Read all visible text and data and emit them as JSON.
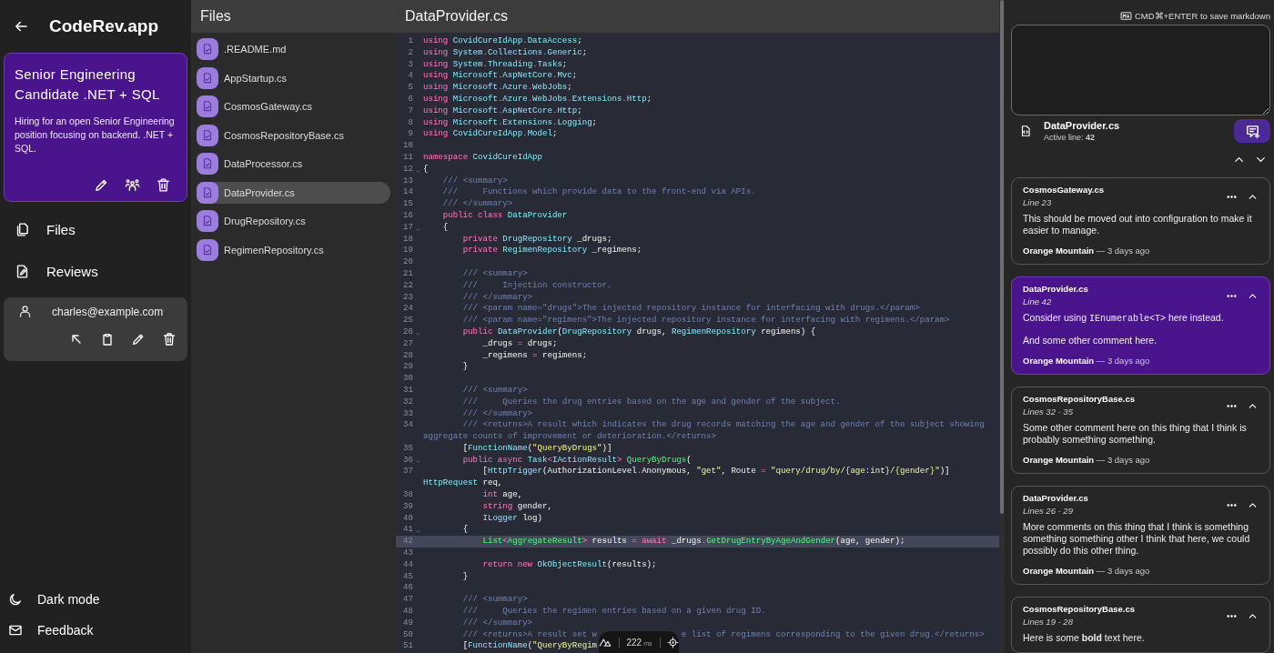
{
  "sidebar": {
    "app_title": "CodeRev.app",
    "project": {
      "title": "Senior Engineering Candidate .NET + SQL",
      "description": "Hiring for an open Senior Engineering position focusing on backend. .NET + SQL."
    },
    "nav": [
      {
        "label": "Files"
      },
      {
        "label": "Reviews"
      }
    ],
    "user": {
      "email": "charles@example.com"
    },
    "footer": [
      {
        "label": "Dark mode"
      },
      {
        "label": "Feedback"
      }
    ]
  },
  "files": {
    "title": "Files",
    "items": [
      {
        "name": ".README.md",
        "selected": false
      },
      {
        "name": "AppStartup.cs",
        "selected": false
      },
      {
        "name": "CosmosGateway.cs",
        "selected": false
      },
      {
        "name": "CosmosRepositoryBase.cs",
        "selected": false
      },
      {
        "name": "DataProcessor.cs",
        "selected": false
      },
      {
        "name": "DataProvider.cs",
        "selected": true
      },
      {
        "name": "DrugRepository.cs",
        "selected": false
      },
      {
        "name": "RegimenRepository.cs",
        "selected": false
      }
    ]
  },
  "editor": {
    "title": "DataProvider.cs",
    "perf": {
      "value": "222",
      "unit": "ms"
    },
    "lines": [
      {
        "n": "1",
        "fold": false,
        "active": false,
        "tokens": [
          {
            "kind": "kw",
            "text": "using "
          },
          {
            "kind": "ty",
            "text": "CovidCureIdApp"
          },
          {
            "kind": "op",
            "text": "."
          },
          {
            "kind": "ty",
            "text": "DataAccess"
          },
          {
            "kind": "tx",
            "text": ";"
          }
        ]
      },
      {
        "n": "2",
        "fold": false,
        "active": false,
        "tokens": [
          {
            "kind": "kw",
            "text": "using "
          },
          {
            "kind": "ty",
            "text": "System"
          },
          {
            "kind": "op",
            "text": "."
          },
          {
            "kind": "ty",
            "text": "Collections"
          },
          {
            "kind": "op",
            "text": "."
          },
          {
            "kind": "ty",
            "text": "Generic"
          },
          {
            "kind": "tx",
            "text": ";"
          }
        ]
      },
      {
        "n": "3",
        "fold": false,
        "active": false,
        "tokens": [
          {
            "kind": "kw",
            "text": "using "
          },
          {
            "kind": "ty",
            "text": "System"
          },
          {
            "kind": "op",
            "text": "."
          },
          {
            "kind": "ty",
            "text": "Threading"
          },
          {
            "kind": "op",
            "text": "."
          },
          {
            "kind": "ty",
            "text": "Tasks"
          },
          {
            "kind": "tx",
            "text": ";"
          }
        ]
      },
      {
        "n": "4",
        "fold": false,
        "active": false,
        "tokens": [
          {
            "kind": "kw",
            "text": "using "
          },
          {
            "kind": "ty",
            "text": "Microsoft"
          },
          {
            "kind": "op",
            "text": "."
          },
          {
            "kind": "ty",
            "text": "AspNetCore"
          },
          {
            "kind": "op",
            "text": "."
          },
          {
            "kind": "ty",
            "text": "Mvc"
          },
          {
            "kind": "tx",
            "text": ";"
          }
        ]
      },
      {
        "n": "5",
        "fold": false,
        "active": false,
        "tokens": [
          {
            "kind": "kw",
            "text": "using "
          },
          {
            "kind": "ty",
            "text": "Microsoft"
          },
          {
            "kind": "op",
            "text": "."
          },
          {
            "kind": "ty",
            "text": "Azure"
          },
          {
            "kind": "op",
            "text": "."
          },
          {
            "kind": "ty",
            "text": "WebJobs"
          },
          {
            "kind": "tx",
            "text": ";"
          }
        ]
      },
      {
        "n": "6",
        "fold": false,
        "active": false,
        "tokens": [
          {
            "kind": "kw",
            "text": "using "
          },
          {
            "kind": "ty",
            "text": "Microsoft"
          },
          {
            "kind": "op",
            "text": "."
          },
          {
            "kind": "ty",
            "text": "Azure"
          },
          {
            "kind": "op",
            "text": "."
          },
          {
            "kind": "ty",
            "text": "WebJobs"
          },
          {
            "kind": "op",
            "text": "."
          },
          {
            "kind": "ty",
            "text": "Extensions"
          },
          {
            "kind": "op",
            "text": "."
          },
          {
            "kind": "ty",
            "text": "Http"
          },
          {
            "kind": "tx",
            "text": ";"
          }
        ]
      },
      {
        "n": "7",
        "fold": false,
        "active": false,
        "tokens": [
          {
            "kind": "kw",
            "text": "using "
          },
          {
            "kind": "ty",
            "text": "Microsoft"
          },
          {
            "kind": "op",
            "text": "."
          },
          {
            "kind": "ty",
            "text": "AspNetCore"
          },
          {
            "kind": "op",
            "text": "."
          },
          {
            "kind": "ty",
            "text": "Http"
          },
          {
            "kind": "tx",
            "text": ";"
          }
        ]
      },
      {
        "n": "8",
        "fold": false,
        "active": false,
        "tokens": [
          {
            "kind": "kw",
            "text": "using "
          },
          {
            "kind": "ty",
            "text": "Microsoft"
          },
          {
            "kind": "op",
            "text": "."
          },
          {
            "kind": "ty",
            "text": "Extensions"
          },
          {
            "kind": "op",
            "text": "."
          },
          {
            "kind": "ty",
            "text": "Logging"
          },
          {
            "kind": "tx",
            "text": ";"
          }
        ]
      },
      {
        "n": "9",
        "fold": false,
        "active": false,
        "tokens": [
          {
            "kind": "kw",
            "text": "using "
          },
          {
            "kind": "ty",
            "text": "CovidCureIdApp"
          },
          {
            "kind": "op",
            "text": "."
          },
          {
            "kind": "ty",
            "text": "Model"
          },
          {
            "kind": "tx",
            "text": ";"
          }
        ]
      },
      {
        "n": "10",
        "fold": false,
        "active": false
      },
      {
        "n": "11",
        "fold": false,
        "active": false,
        "tokens": [
          {
            "kind": "kw",
            "text": "namespace "
          },
          {
            "kind": "ty",
            "text": "CovidCureIdApp"
          }
        ]
      },
      {
        "n": "12",
        "fold": true,
        "active": false,
        "tokens": [
          {
            "kind": "tx",
            "text": "{"
          }
        ]
      },
      {
        "n": "13",
        "fold": false,
        "active": false,
        "tokens": [
          {
            "kind": "cm",
            "text": "    /// <summary>"
          }
        ]
      },
      {
        "n": "14",
        "fold": false,
        "active": false,
        "tokens": [
          {
            "kind": "cm",
            "text": "    ///     Functions which provide data to the front-end via APIs."
          }
        ]
      },
      {
        "n": "15",
        "fold": false,
        "active": false,
        "tokens": [
          {
            "kind": "cm",
            "text": "    /// </summary>"
          }
        ]
      },
      {
        "n": "16",
        "fold": false,
        "active": false,
        "tokens": [
          {
            "kind": "kw",
            "text": "    public class "
          },
          {
            "kind": "ty",
            "text": "DataProvider"
          }
        ]
      },
      {
        "n": "17",
        "fold": true,
        "active": false,
        "tokens": [
          {
            "kind": "tx",
            "text": "    {"
          }
        ]
      },
      {
        "n": "18",
        "fold": false,
        "active": false,
        "tokens": [
          {
            "kind": "kw",
            "text": "        private "
          },
          {
            "kind": "ty",
            "text": "DrugRepository"
          },
          {
            "kind": "tx",
            "text": " _drugs;"
          }
        ]
      },
      {
        "n": "19",
        "fold": false,
        "active": false,
        "tokens": [
          {
            "kind": "kw",
            "text": "        private "
          },
          {
            "kind": "ty",
            "text": "RegimenRepository"
          },
          {
            "kind": "tx",
            "text": " _regimens;"
          }
        ]
      },
      {
        "n": "20",
        "fold": false,
        "active": false
      },
      {
        "n": "21",
        "fold": false,
        "active": false,
        "tokens": [
          {
            "kind": "cm",
            "text": "        /// <summary>"
          }
        ]
      },
      {
        "n": "22",
        "fold": false,
        "active": false,
        "tokens": [
          {
            "kind": "cm",
            "text": "        ///     Injection constructor."
          }
        ]
      },
      {
        "n": "23",
        "fold": false,
        "active": false,
        "tokens": [
          {
            "kind": "cm",
            "text": "        /// </summary>"
          }
        ]
      },
      {
        "n": "24",
        "fold": false,
        "active": false,
        "tokens": [
          {
            "kind": "cm",
            "text": "        /// <param name=\"drugs\">The injected repository instance for interfacing with drugs.</param>"
          }
        ]
      },
      {
        "n": "25",
        "fold": false,
        "active": false,
        "tokens": [
          {
            "kind": "cm",
            "text": "        /// <param name=\"regimens\">The injected repository instance for interfacing with regimens.</param>"
          }
        ]
      },
      {
        "n": "26",
        "fold": true,
        "active": false,
        "tokens": [
          {
            "kind": "kw",
            "text": "        public "
          },
          {
            "kind": "ty",
            "text": "DataProvider"
          },
          {
            "kind": "tx",
            "text": "("
          },
          {
            "kind": "ty",
            "text": "DrugRepository"
          },
          {
            "kind": "tx",
            "text": " drugs, "
          },
          {
            "kind": "ty",
            "text": "RegimenRepository"
          },
          {
            "kind": "tx",
            "text": " regimens) {"
          }
        ]
      },
      {
        "n": "27",
        "fold": false,
        "active": false,
        "tokens": [
          {
            "kind": "tx",
            "text": "            _drugs "
          },
          {
            "kind": "op",
            "text": "="
          },
          {
            "kind": "tx",
            "text": " drugs;"
          }
        ]
      },
      {
        "n": "28",
        "fold": false,
        "active": false,
        "tokens": [
          {
            "kind": "tx",
            "text": "            _regimens "
          },
          {
            "kind": "op",
            "text": "="
          },
          {
            "kind": "tx",
            "text": " regimens;"
          }
        ]
      },
      {
        "n": "29",
        "fold": false,
        "active": false,
        "tokens": [
          {
            "kind": "tx",
            "text": "        }"
          }
        ]
      },
      {
        "n": "30",
        "fold": false,
        "active": false
      },
      {
        "n": "31",
        "fold": false,
        "active": false,
        "tokens": [
          {
            "kind": "cm",
            "text": "        /// <summary>"
          }
        ]
      },
      {
        "n": "32",
        "fold": false,
        "active": false,
        "tokens": [
          {
            "kind": "cm",
            "text": "        ///     Queries the drug entries based on the age and gender of the subject."
          }
        ]
      },
      {
        "n": "33",
        "fold": false,
        "active": false,
        "tokens": [
          {
            "kind": "cm",
            "text": "        /// </summary>"
          }
        ]
      },
      {
        "n": "34",
        "fold": false,
        "active": false,
        "tokens": [
          {
            "kind": "cm",
            "text": "        /// <returns>A result which indicates the drug records matching the age and gender of the subject showing aggregate counts of improvement or deterioration.</returns>"
          }
        ]
      },
      {
        "n": "35",
        "fold": false,
        "active": false,
        "tokens": [
          {
            "kind": "tx",
            "text": "        ["
          },
          {
            "kind": "ty",
            "text": "FunctionName"
          },
          {
            "kind": "tx",
            "text": "("
          },
          {
            "kind": "st",
            "text": "\"QueryByDrugs\""
          },
          {
            "kind": "tx",
            "text": ")]"
          }
        ]
      },
      {
        "n": "36",
        "fold": true,
        "active": false,
        "tokens": [
          {
            "kind": "kw",
            "text": "        public async "
          },
          {
            "kind": "ty",
            "text": "Task"
          },
          {
            "kind": "op",
            "text": "<"
          },
          {
            "kind": "ty",
            "text": "IActionResult"
          },
          {
            "kind": "op",
            "text": "> "
          },
          {
            "kind": "fn",
            "text": "QueryByDrugs"
          },
          {
            "kind": "tx",
            "text": "("
          }
        ]
      },
      {
        "n": "37",
        "fold": false,
        "active": false,
        "tokens": [
          {
            "kind": "tx",
            "text": "            ["
          },
          {
            "kind": "ty",
            "text": "HttpTrigger"
          },
          {
            "kind": "tx",
            "text": "(AuthorizationLevel"
          },
          {
            "kind": "op",
            "text": "."
          },
          {
            "kind": "tx",
            "text": "Anonymous, "
          },
          {
            "kind": "st",
            "text": "\"get\""
          },
          {
            "kind": "tx",
            "text": ", Route "
          },
          {
            "kind": "op",
            "text": "= "
          },
          {
            "kind": "st",
            "text": "\"query/drug/by/{age:int}/{gender}\""
          },
          {
            "kind": "tx",
            "text": ")] "
          },
          {
            "kind": "ty",
            "text": "HttpRequest"
          },
          {
            "kind": "tx",
            "text": " req,"
          }
        ]
      },
      {
        "n": "38",
        "fold": false,
        "active": false,
        "tokens": [
          {
            "kind": "kw",
            "text": "            int"
          },
          {
            "kind": "tx",
            "text": " age,"
          }
        ]
      },
      {
        "n": "39",
        "fold": false,
        "active": false,
        "tokens": [
          {
            "kind": "kw",
            "text": "            string"
          },
          {
            "kind": "tx",
            "text": " gender,"
          }
        ]
      },
      {
        "n": "40",
        "fold": false,
        "active": false,
        "tokens": [
          {
            "kind": "ty",
            "text": "            ILogger"
          },
          {
            "kind": "tx",
            "text": " log)"
          }
        ]
      },
      {
        "n": "41",
        "fold": true,
        "active": false,
        "tokens": [
          {
            "kind": "tx",
            "text": "        {"
          }
        ]
      },
      {
        "n": "42",
        "fold": false,
        "active": true,
        "tokens": [
          {
            "kind": "fn",
            "text": "            List"
          },
          {
            "kind": "op",
            "text": "<"
          },
          {
            "kind": "fn",
            "text": "AggregateResult"
          },
          {
            "kind": "op",
            "text": ">"
          },
          {
            "kind": "tx",
            "text": " results "
          },
          {
            "kind": "op",
            "text": "="
          },
          {
            "kind": "kw",
            "text": " await"
          },
          {
            "kind": "tx",
            "text": " _drugs"
          },
          {
            "kind": "op",
            "text": "."
          },
          {
            "kind": "fn",
            "text": "GetDrugEntryByAgeAndGender"
          },
          {
            "kind": "tx",
            "text": "(age, gender);"
          }
        ]
      },
      {
        "n": "43",
        "fold": false,
        "active": false
      },
      {
        "n": "44",
        "fold": false,
        "active": false,
        "tokens": [
          {
            "kind": "kw",
            "text": "            return new "
          },
          {
            "kind": "ty",
            "text": "OkObjectResult"
          },
          {
            "kind": "tx",
            "text": "(results);"
          }
        ]
      },
      {
        "n": "45",
        "fold": false,
        "active": false,
        "tokens": [
          {
            "kind": "tx",
            "text": "        }"
          }
        ]
      },
      {
        "n": "46",
        "fold": false,
        "active": false
      },
      {
        "n": "47",
        "fold": false,
        "active": false,
        "tokens": [
          {
            "kind": "cm",
            "text": "        /// <summary>"
          }
        ]
      },
      {
        "n": "48",
        "fold": false,
        "active": false,
        "tokens": [
          {
            "kind": "cm",
            "text": "        ///     Queries the regimen entries based on a given drug ID."
          }
        ]
      },
      {
        "n": "49",
        "fold": false,
        "active": false,
        "tokens": [
          {
            "kind": "cm",
            "text": "        /// </summary>"
          }
        ]
      },
      {
        "n": "50",
        "fold": false,
        "active": false,
        "tokens": [
          {
            "kind": "cm",
            "text": "        /// <returns>A result set w                 "
          },
          {
            "kind": "cm",
            "text": "e list of regimens corresponding to the given drug.</returns>"
          }
        ]
      },
      {
        "n": "51",
        "fold": false,
        "active": false,
        "tokens": [
          {
            "kind": "tx",
            "text": "        ["
          },
          {
            "kind": "ty",
            "text": "FunctionName"
          },
          {
            "kind": "tx",
            "text": "("
          },
          {
            "kind": "st",
            "text": "\"QueryByRegim"
          }
        ]
      }
    ]
  },
  "review": {
    "hint": "CMD⌘+ENTER to save markdown",
    "file": {
      "name": "DataProvider.cs",
      "active_line": "Active line: **42**"
    },
    "comments": [
      {
        "file": "CosmosGateway.cs",
        "lines": "Line 23",
        "selected": false,
        "paragraphs": [
          [
            {
              "kind": "text",
              "text": "This should be moved out into configuration to make it easier to manage."
            }
          ]
        ],
        "meta": "**Orange Mountain** — 3 days ago"
      },
      {
        "file": "DataProvider.cs",
        "lines": "Line 42",
        "selected": true,
        "paragraphs": [
          [
            {
              "kind": "text",
              "text": "Consider using "
            },
            {
              "kind": "code",
              "text": "IEnumerable<T>"
            },
            {
              "kind": "text",
              "text": " here instead."
            }
          ],
          [
            {
              "kind": "text",
              "text": "And some other comment here."
            }
          ]
        ],
        "meta": "**Orange Mountain** — 3 days ago"
      },
      {
        "file": "CosmosRepositoryBase.cs",
        "lines": "Lines 32 - 35",
        "selected": false,
        "paragraphs": [
          [
            {
              "kind": "text",
              "text": "Some other comment here on this thing that I think is probably something something."
            }
          ]
        ],
        "meta": "**Orange Mountain** — 3 days ago"
      },
      {
        "file": "DataProvider.cs",
        "lines": "Lines 26 - 29",
        "selected": false,
        "paragraphs": [
          [
            {
              "kind": "text",
              "text": "More comments on this thing that I think is something something something other I think that here, we could possibly do this other thing."
            }
          ]
        ],
        "meta": "**Orange Mountain** — 3 days ago"
      },
      {
        "file": "CosmosRepositoryBase.cs",
        "lines": "Lines 19 - 28",
        "selected": false,
        "paragraphs": [
          [
            {
              "kind": "text",
              "text": "Here is some **bold** text here."
            }
          ]
        ]
      }
    ]
  }
}
